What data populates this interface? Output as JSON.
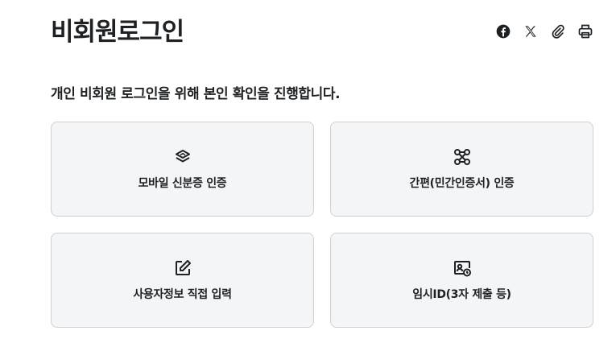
{
  "page": {
    "title": "비회원로그인",
    "lead": "개인 비회원 로그인을 위해 본인 확인을 진행합니다."
  },
  "toolbar": {
    "icons": [
      "facebook-icon",
      "x-icon",
      "link-icon",
      "print-icon"
    ]
  },
  "options": [
    {
      "label": "모바일 신분증 인증",
      "icon": "mobile-id-icon"
    },
    {
      "label": "간편(민간인증서) 인증",
      "icon": "connect-icon"
    },
    {
      "label": "사용자정보 직접 입력",
      "icon": "edit-icon"
    },
    {
      "label": "임시ID(3자 제출 등)",
      "icon": "temp-id-icon"
    }
  ],
  "colors": {
    "text": "#1e2124",
    "card_bg": "#f4f5f6",
    "card_border": "#cdd1d5"
  }
}
